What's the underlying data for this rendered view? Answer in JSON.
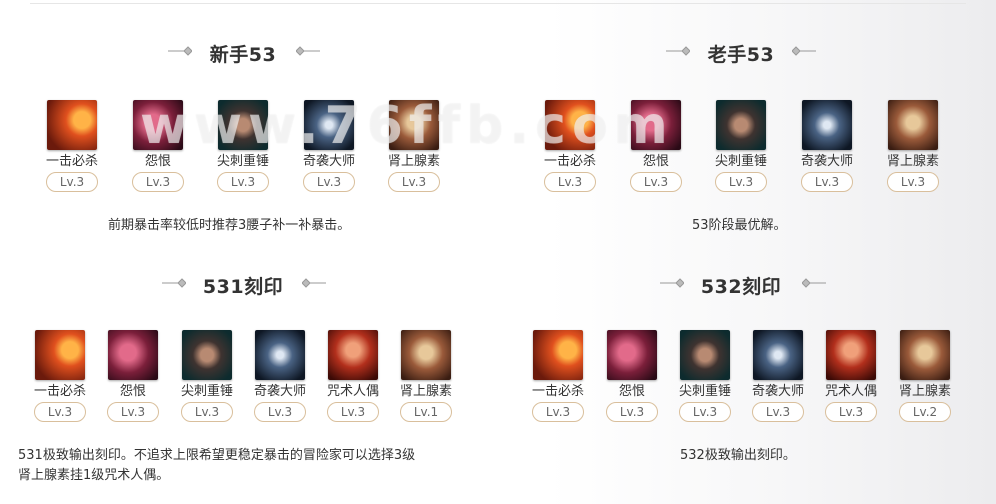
{
  "watermark": "www.76ffb.com",
  "sections": [
    {
      "title": "新手53",
      "skills": [
        {
          "name": "一击必杀",
          "level": "Lv.3",
          "icon": "fist-strike-icon"
        },
        {
          "name": "怨恨",
          "level": "Lv.3",
          "icon": "grudge-demon-icon"
        },
        {
          "name": "尖刺重锤",
          "level": "Lv.3",
          "icon": "spiked-mace-icon"
        },
        {
          "name": "奇袭大师",
          "level": "Lv.3",
          "icon": "ambush-master-icon"
        },
        {
          "name": "肾上腺素",
          "level": "Lv.3",
          "icon": "adrenaline-icon"
        }
      ],
      "note": "前期暴击率较低时推荐3腰子补一补暴击。"
    },
    {
      "title": "老手53",
      "skills": [
        {
          "name": "一击必杀",
          "level": "Lv.3",
          "icon": "fist-strike-icon"
        },
        {
          "name": "怨恨",
          "level": "Lv.3",
          "icon": "grudge-demon-icon"
        },
        {
          "name": "尖刺重锤",
          "level": "Lv.3",
          "icon": "spiked-mace-icon"
        },
        {
          "name": "奇袭大师",
          "level": "Lv.3",
          "icon": "ambush-master-icon"
        },
        {
          "name": "肾上腺素",
          "level": "Lv.3",
          "icon": "adrenaline-icon"
        }
      ],
      "note": "53阶段最优解。"
    },
    {
      "title": "531刻印",
      "skills": [
        {
          "name": "一击必杀",
          "level": "Lv.3",
          "icon": "fist-strike-icon"
        },
        {
          "name": "怨恨",
          "level": "Lv.3",
          "icon": "grudge-demon-icon"
        },
        {
          "name": "尖刺重锤",
          "level": "Lv.3",
          "icon": "spiked-mace-icon"
        },
        {
          "name": "奇袭大师",
          "level": "Lv.3",
          "icon": "ambush-master-icon"
        },
        {
          "name": "咒术人偶",
          "level": "Lv.3",
          "icon": "cursed-doll-icon"
        },
        {
          "name": "肾上腺素",
          "level": "Lv.1",
          "icon": "adrenaline-icon"
        }
      ],
      "note_lines": [
        "531极致输出刻印。不追求上限希望更稳定暴击的冒险家可以选择3级",
        "肾上腺素挂1级咒术人偶。"
      ]
    },
    {
      "title": "532刻印",
      "skills": [
        {
          "name": "一击必杀",
          "level": "Lv.3",
          "icon": "fist-strike-icon"
        },
        {
          "name": "怨恨",
          "level": "Lv.3",
          "icon": "grudge-demon-icon"
        },
        {
          "name": "尖刺重锤",
          "level": "Lv.3",
          "icon": "spiked-mace-icon"
        },
        {
          "name": "奇袭大师",
          "level": "Lv.3",
          "icon": "ambush-master-icon"
        },
        {
          "name": "咒术人偶",
          "level": "Lv.3",
          "icon": "cursed-doll-icon"
        },
        {
          "name": "肾上腺素",
          "level": "Lv.2",
          "icon": "adrenaline-icon"
        }
      ],
      "note": "532极致输出刻印。"
    }
  ]
}
